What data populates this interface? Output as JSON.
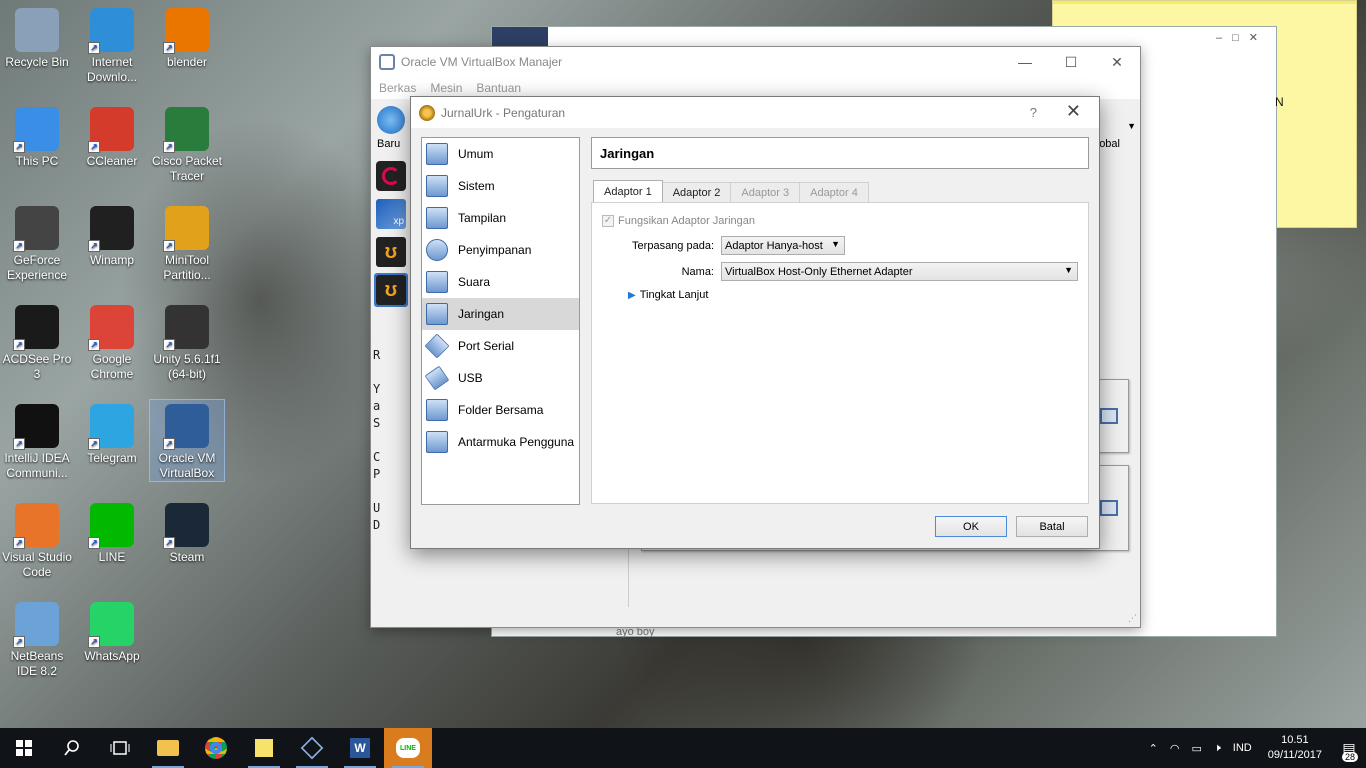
{
  "desktop": {
    "icons": [
      {
        "label": "Recycle Bin",
        "color": "#8aa0b8"
      },
      {
        "label": "Internet Downlo...",
        "color": "#2e8fd8"
      },
      {
        "label": "blender",
        "color": "#ea7600"
      },
      {
        "label": "This PC",
        "color": "#3a8ee6"
      },
      {
        "label": "CCleaner",
        "color": "#d43b2a"
      },
      {
        "label": "Cisco Packet Tracer",
        "color": "#2a7c3c"
      },
      {
        "label": "GeForce Experience",
        "color": "#444444"
      },
      {
        "label": "Winamp",
        "color": "#202020"
      },
      {
        "label": "MiniTool Partitio...",
        "color": "#e2a11a"
      },
      {
        "label": "ACDSee Pro 3",
        "color": "#1a1a1a"
      },
      {
        "label": "Google Chrome",
        "color": "#db4437"
      },
      {
        "label": "Unity 5.6.1f1 (64-bit)",
        "color": "#333333"
      },
      {
        "label": "IntelliJ IDEA Communi...",
        "color": "#111111"
      },
      {
        "label": "Telegram",
        "color": "#2ca5e0"
      },
      {
        "label": "Oracle VM VirtualBox",
        "color": "#2e5d9a"
      },
      {
        "label": "Visual Studio Code",
        "color": "#e8742a"
      },
      {
        "label": "LINE",
        "color": "#00b900"
      },
      {
        "label": "Steam",
        "color": "#1b2838"
      },
      {
        "label": "NetBeans IDE 8.2",
        "color": "#6ba3d8"
      },
      {
        "label": "WhatsApp",
        "color": "#25d366"
      }
    ]
  },
  "background_window": {
    "right_text": "N",
    "bottom_text": "ayo boy"
  },
  "manager": {
    "title": "Oracle VM VirtualBox Manajer",
    "menu": [
      "Berkas",
      "Mesin",
      "Bantuan"
    ],
    "toolbar_new_label": "Baru",
    "global_label": "lobal",
    "strip_text": [
      "R",
      "",
      "Y",
      "a",
      "S",
      "",
      "C",
      "P",
      "",
      "U",
      "D"
    ]
  },
  "dialog": {
    "title": "JurnalUrk - Pengaturan",
    "help": "?",
    "categories": [
      {
        "label": "Umum"
      },
      {
        "label": "Sistem"
      },
      {
        "label": "Tampilan"
      },
      {
        "label": "Penyimpanan"
      },
      {
        "label": "Suara"
      },
      {
        "label": "Jaringan"
      },
      {
        "label": "Port Serial"
      },
      {
        "label": "USB"
      },
      {
        "label": "Folder Bersama"
      },
      {
        "label": "Antarmuka Pengguna"
      }
    ],
    "active_category": "Jaringan",
    "section_title": "Jaringan",
    "tabs": [
      "Adaptor 1",
      "Adaptor 2",
      "Adaptor 3",
      "Adaptor 4"
    ],
    "enable_adapter_label": "Fungsikan Adaptor Jaringan",
    "attached_label": "Terpasang pada:",
    "attached_value": "Adaptor Hanya-host",
    "name_label": "Nama:",
    "name_value": "VirtualBox Host-Only Ethernet Adapter",
    "advanced_label": "Tingkat Lanjut",
    "ok_label": "OK",
    "cancel_label": "Batal"
  },
  "taskbar": {
    "language": "IND",
    "time": "10.51",
    "date": "09/11/2017",
    "notification_count": "28",
    "accent": "#d97c1e"
  }
}
